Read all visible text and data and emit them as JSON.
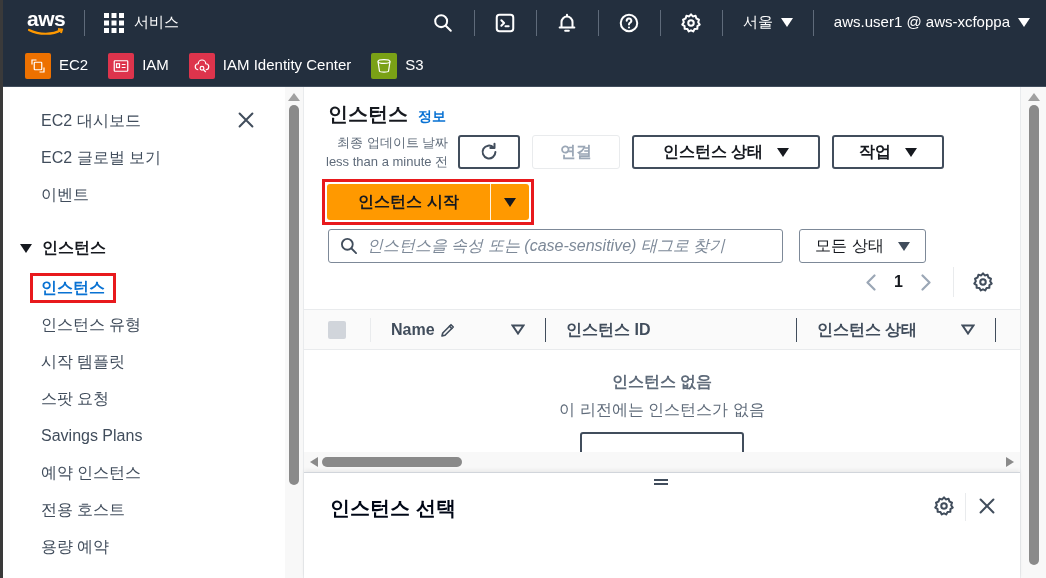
{
  "top_nav": {
    "logo": "aws",
    "services": "서비스",
    "region": "서울",
    "account": "aws.user1 @ aws-xcfoppa"
  },
  "favorites": [
    {
      "label": "EC2",
      "color": "#ed7100",
      "kind": "chip"
    },
    {
      "label": "IAM",
      "color": "#dd344c",
      "kind": "card"
    },
    {
      "label": "IAM Identity Center",
      "color": "#dd344c",
      "kind": "cloud"
    },
    {
      "label": "S3",
      "color": "#7aa116",
      "kind": "bucket"
    }
  ],
  "sidebar": {
    "items": [
      {
        "kind": "link",
        "label": "EC2 대시보드",
        "selected": false,
        "highlighted": false
      },
      {
        "kind": "link",
        "label": "EC2 글로벌 보기",
        "selected": false,
        "highlighted": false
      },
      {
        "kind": "link",
        "label": "이벤트",
        "selected": false,
        "highlighted": false
      },
      {
        "kind": "section",
        "label": "인스턴스",
        "expanded": true,
        "children": [
          {
            "kind": "link",
            "label": "인스턴스",
            "selected": true,
            "highlighted": true
          },
          {
            "kind": "link",
            "label": "인스턴스 유형",
            "selected": false,
            "highlighted": false
          },
          {
            "kind": "link",
            "label": "시작 템플릿",
            "selected": false,
            "highlighted": false
          },
          {
            "kind": "link",
            "label": "스팟 요청",
            "selected": false,
            "highlighted": false
          },
          {
            "kind": "link",
            "label": "Savings Plans",
            "selected": false,
            "highlighted": false
          },
          {
            "kind": "link",
            "label": "예약 인스턴스",
            "selected": false,
            "highlighted": false
          },
          {
            "kind": "link",
            "label": "전용 호스트",
            "selected": false,
            "highlighted": false
          },
          {
            "kind": "link",
            "label": "용량 예약",
            "selected": false,
            "highlighted": false
          }
        ]
      }
    ]
  },
  "page": {
    "title": "인스턴스",
    "info_link": "정보",
    "last_updated_label": "최종 업데이트 날짜",
    "last_updated_time": "less than a minute 전",
    "buttons": [
      {
        "label": "연결",
        "disabled": true,
        "dropdown": false
      },
      {
        "label": "인스턴스 상태",
        "disabled": false,
        "dropdown": true
      },
      {
        "label": "작업",
        "disabled": false,
        "dropdown": true
      }
    ],
    "launch_button": {
      "label": "인스턴스 시작",
      "highlighted": true
    },
    "search": {
      "placeholder": "인스턴스을 속성 또는 (case-sensitive) 태그로 찾기"
    },
    "state_filter": "모든 상태",
    "pagination": {
      "page": "1"
    }
  },
  "table": {
    "select_all_checked": false,
    "columns": [
      {
        "label": "Name",
        "editable": true,
        "sortable": true
      },
      {
        "label": "인스턴스 ID",
        "editable": false,
        "sortable": false
      },
      {
        "label": "인스턴스 상태",
        "editable": false,
        "sortable": true
      }
    ],
    "empty_title": "인스턴스 없음",
    "empty_message": "이 리전에는 인스턴스가 없음"
  },
  "detail_panel": {
    "title": "인스턴스 선택"
  }
}
